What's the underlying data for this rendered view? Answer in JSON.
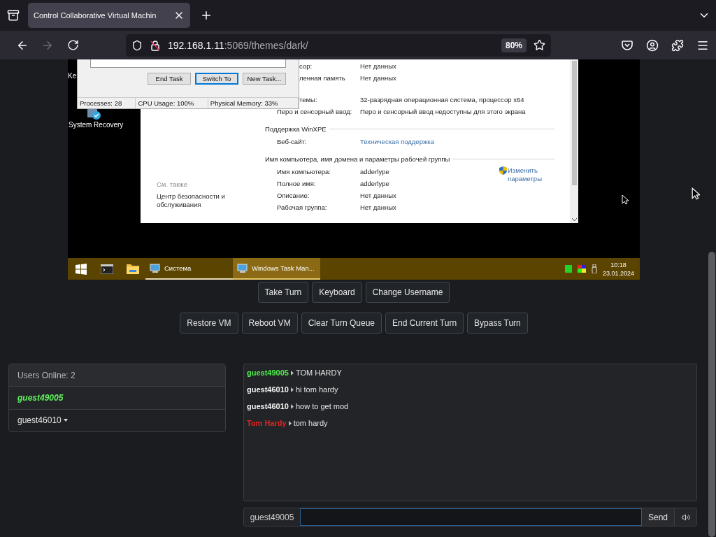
{
  "browser": {
    "tab": {
      "title": "Control Collaborative Virtual Machin",
      "selected": true
    },
    "address": {
      "host": "192.168.1.11",
      "rest": ":5069/themes/dark/"
    },
    "zoom": "80%"
  },
  "vm": {
    "desktop_icons": [
      {
        "label": "Ke"
      },
      {
        "label": "System Recovery"
      }
    ],
    "task_manager": {
      "buttons": [
        {
          "label": "End Task",
          "selected": false
        },
        {
          "label": "Switch To",
          "selected": true
        },
        {
          "label": "New Task...",
          "selected": false
        }
      ],
      "status": [
        "Processes: 28",
        "CPU Usage: 100%",
        "Physical Memory: 33%"
      ]
    },
    "system_window": {
      "see_also": "См. также",
      "see_also_links": [
        "Центр безопасности и обслуживания"
      ],
      "groups": [
        {
          "rows": [
            {
              "label": "сор:",
              "value": "Нет данных",
              "kind": "text",
              "covered": true
            },
            {
              "label": "ленная память",
              "value": "Нет данных",
              "kind": "text",
              "covered": true
            }
          ]
        },
        {
          "rows": [
            {
              "label": "темы:",
              "value": "32-разрядная операционная система, процессор x64",
              "kind": "text",
              "covered": true
            },
            {
              "label": "Перо и сенсорный ввод:",
              "value": "Перо и сенсорный ввод недоступны для этого экрана",
              "kind": "text",
              "covered": false
            }
          ]
        },
        {
          "title": "Поддержка WinXPE",
          "rows": [
            {
              "label": "Веб-сайт:",
              "value": "Техническая поддержка",
              "kind": "link",
              "covered": false
            }
          ]
        },
        {
          "title": "Имя компьютера, имя домена и параметры рабочей группы",
          "action": "Изменить параметры",
          "rows": [
            {
              "label": "Имя компьютера:",
              "value": "adderlype",
              "kind": "text",
              "covered": false
            },
            {
              "label": "Полное имя:",
              "value": "adderlype",
              "kind": "text",
              "covered": false
            },
            {
              "label": "Описание:",
              "value": "Нет данных",
              "kind": "text",
              "covered": false
            },
            {
              "label": "Рабочая группа:",
              "value": "Нет данных",
              "kind": "text",
              "covered": false
            }
          ]
        }
      ]
    },
    "taskbar": {
      "items": [
        {
          "label": "Система",
          "selected": false
        },
        {
          "label": "Windows Task Man...",
          "selected": true
        }
      ],
      "time": "10:18",
      "date": "23.01.2024"
    }
  },
  "controls": {
    "row_1": [
      "Take Turn",
      "Keyboard",
      "Change Username"
    ],
    "row_2": [
      "Restore VM",
      "Reboot VM",
      "Clear Turn Queue",
      "End Current Turn",
      "Bypass Turn"
    ]
  },
  "users": {
    "header": "Users Online: 2",
    "items": [
      {
        "name": "guest49005",
        "self": true
      },
      {
        "name": "guest46010",
        "self": false
      }
    ]
  },
  "chat": {
    "messages": [
      {
        "user": "guest49005",
        "color": "#4cf04c",
        "text": "TOM HARDY"
      },
      {
        "user": "guest46010",
        "color": "#f2f2f2",
        "text": "hi tom hardy"
      },
      {
        "user": "guest46010",
        "color": "#f2f2f2",
        "text": "how to get mod"
      },
      {
        "user": "Tom Hardy",
        "color": "#e8211f",
        "text": "tom hardy"
      }
    ],
    "username": "guest49005",
    "send": "Send"
  }
}
